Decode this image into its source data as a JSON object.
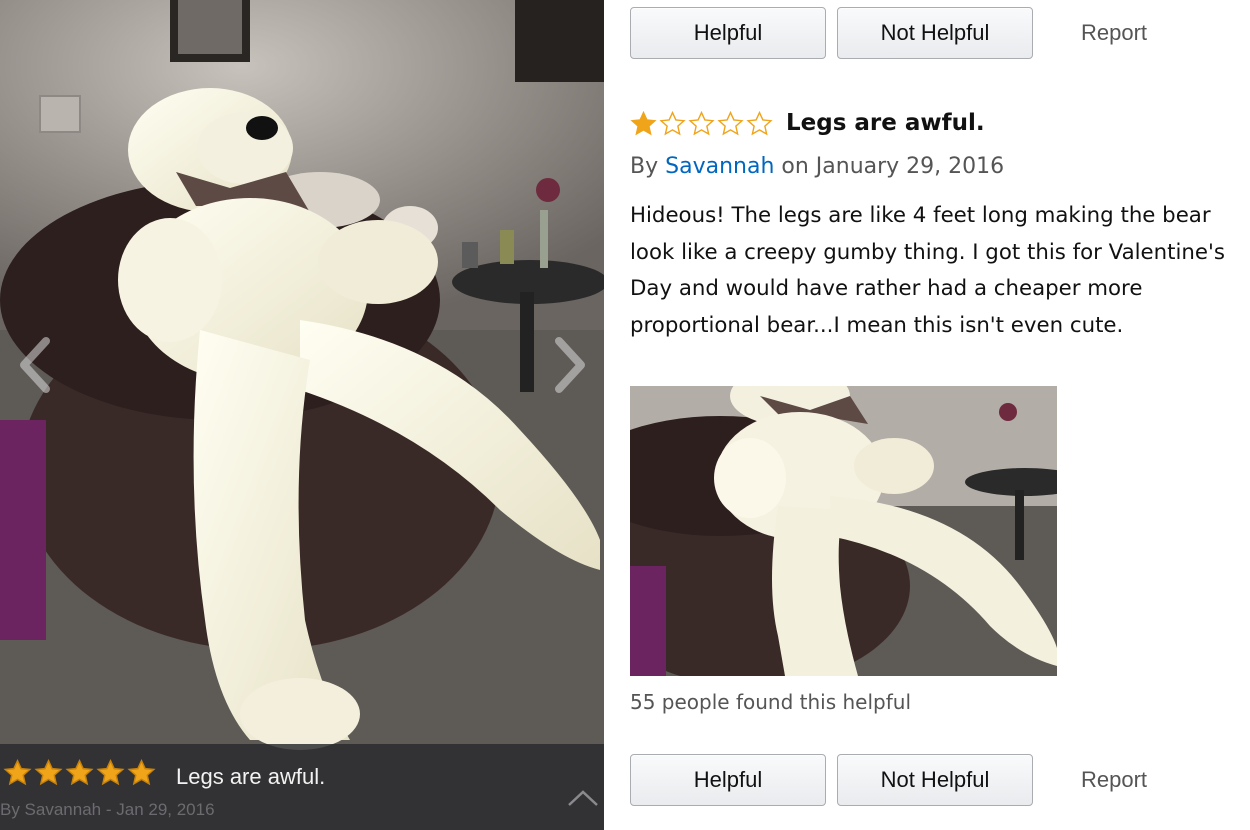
{
  "viewer": {
    "prev_icon": "chevron-left-icon",
    "next_icon": "chevron-right-icon",
    "caret_icon": "chevron-up-icon",
    "rating": 5,
    "title": "Legs are awful.",
    "byline": "By Savannah - Jan 29, 2016"
  },
  "top_actions": {
    "helpful_label": "Helpful",
    "not_helpful_label": "Not Helpful",
    "report_label": "Report"
  },
  "review": {
    "rating": 1,
    "rating_max": 5,
    "star_color": "#f0a41a",
    "title": "Legs are awful.",
    "by_prefix": "By",
    "author": "Savannah",
    "date_text": "on January 29, 2016",
    "body": "Hideous! The legs are like 4 feet long making the bear look like a creepy gumby thing. I got this for Valentine's Day and would have rather had a cheaper more proportional bear...I mean this isn't even cute.",
    "helpful_count_text": "55 people found this helpful",
    "link_color": "#0066c0"
  },
  "bottom_actions": {
    "helpful_label": "Helpful",
    "not_helpful_label": "Not Helpful",
    "report_label": "Report"
  }
}
